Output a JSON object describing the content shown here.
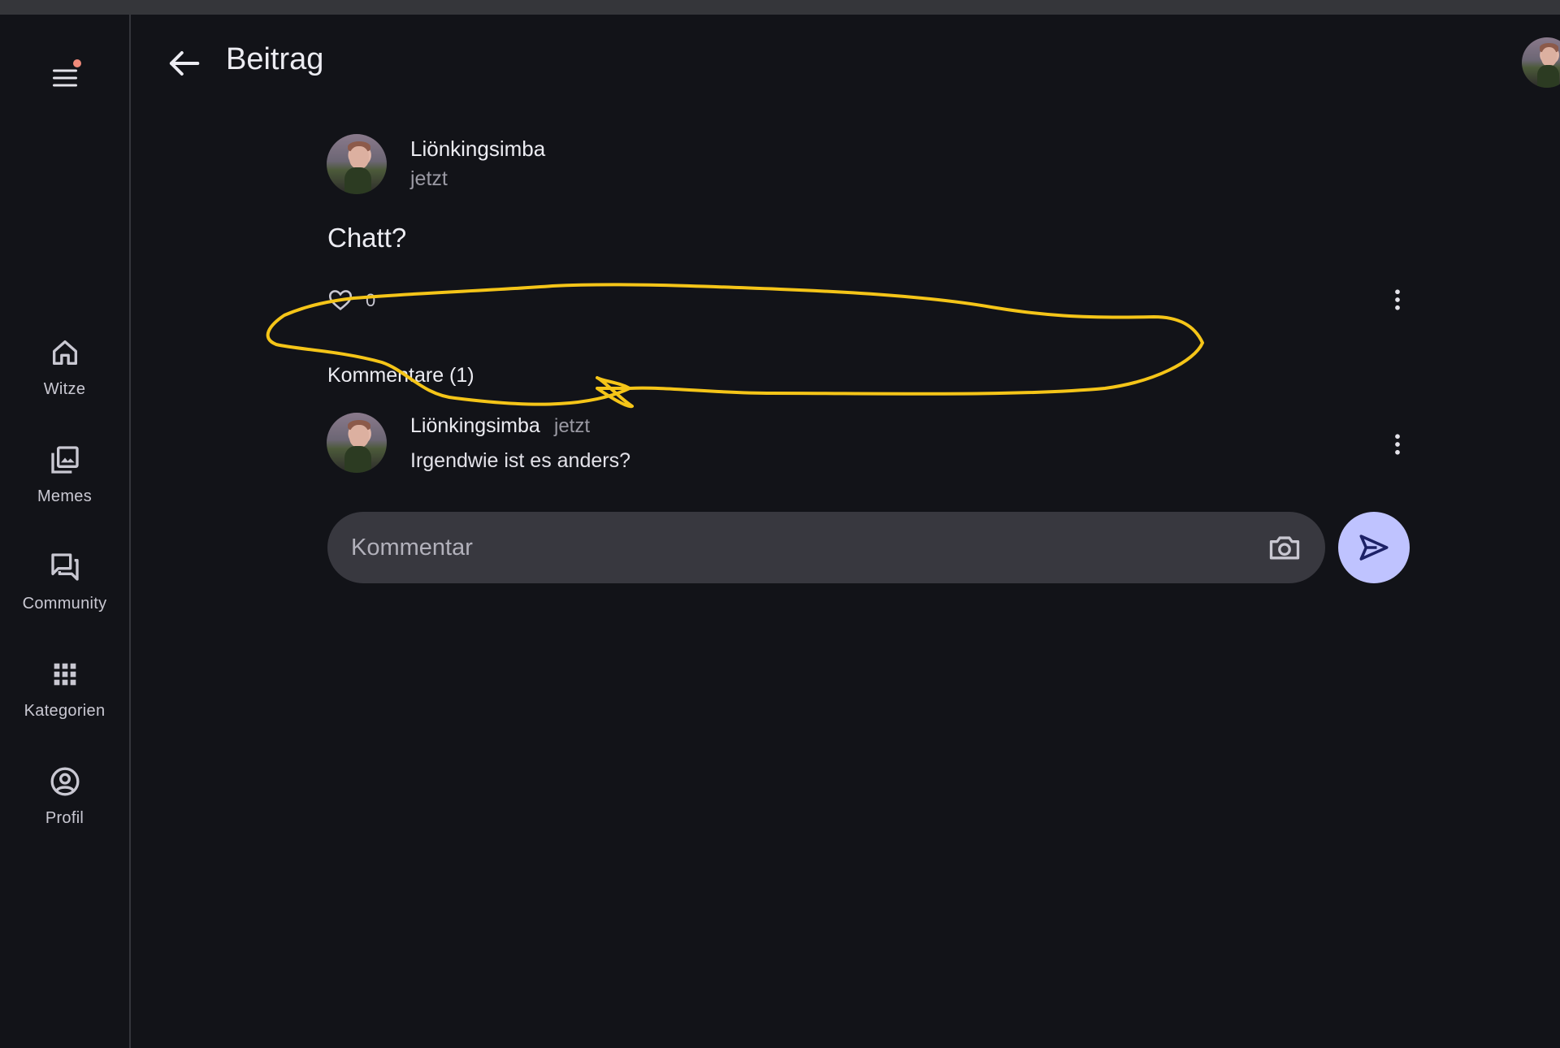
{
  "app": {
    "header": {
      "title": "Beitrag",
      "back_icon": "arrow-back-icon",
      "avatar_icon": "user-avatar"
    },
    "rail": {
      "menu_icon": "hamburger-menu-icon",
      "notification_dot_color": "#f08a7a",
      "items": [
        {
          "label": "Witze",
          "icon": "home-icon"
        },
        {
          "label": "Memes",
          "icon": "image-gallery-icon"
        },
        {
          "label": "Community",
          "icon": "forum-icon"
        },
        {
          "label": "Kategorien",
          "icon": "apps-grid-icon"
        },
        {
          "label": "Profil",
          "icon": "account-circle-icon"
        }
      ]
    },
    "post": {
      "author": "Liönkingsimba",
      "time": "jetzt",
      "text": "Chatt?",
      "like_count": "0",
      "like_icon": "heart-outline-icon",
      "more_icon": "more-vert-icon"
    },
    "comments": {
      "heading": "Kommentare (1)",
      "items": [
        {
          "author": "Liönkingsimba",
          "time": "jetzt",
          "text": "Irgendwie ist es anders?"
        }
      ]
    },
    "composer": {
      "placeholder": "Kommentar",
      "value": "",
      "camera_icon": "camera-icon",
      "send_icon": "send-icon",
      "send_color": "#bfc3ff"
    },
    "annotation": {
      "color": "#f5c518",
      "shape": "hand-drawn-speech-bubble"
    },
    "colors": {
      "background": "#121318",
      "surface": "#38383f",
      "text": "#ececf2",
      "muted": "#9a99a3"
    }
  }
}
